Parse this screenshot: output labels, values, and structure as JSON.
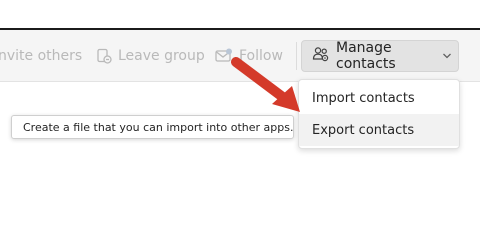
{
  "toolbar": {
    "invite_label": "nvite others",
    "leave_label": "Leave group",
    "follow_label": "Follow",
    "manage_label": "Manage contacts"
  },
  "menu": {
    "items": [
      {
        "label": "Import contacts"
      },
      {
        "label": "Export contacts"
      }
    ]
  },
  "tooltip": {
    "text": "Create a file that you can import into other apps."
  },
  "icons": {
    "leave": "leave-group-icon",
    "follow": "follow-mail-icon",
    "manage": "manage-contacts-people-icon",
    "chevron": "chevron-down-icon",
    "annotation": "red-arrow-annotation"
  },
  "colors": {
    "disabled_text": "#b9b9b9",
    "active_text": "#242424",
    "toolbar_bg": "#f5f5f5",
    "button_active_bg": "#e3e3e3",
    "arrow": "#d43a2a"
  }
}
